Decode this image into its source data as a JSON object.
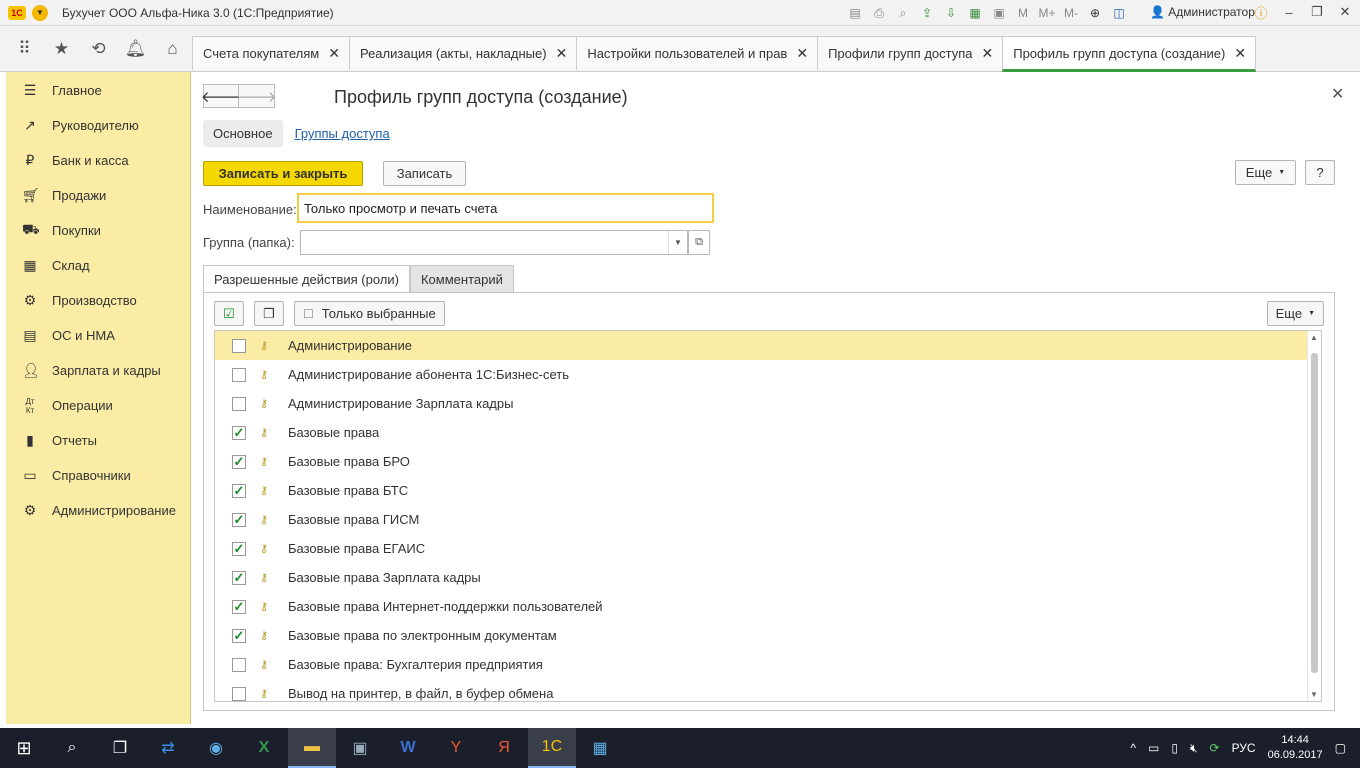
{
  "window": {
    "title": "Бухучет ООО  Альфа-Ника 3.0  (1С:Предприятие)",
    "logo_text": "1С",
    "user": "Администратор",
    "zoom_labels": [
      "M",
      "M+",
      "M-"
    ]
  },
  "tabs": [
    {
      "label": "Счета покупателям"
    },
    {
      "label": "Реализация (акты, накладные)"
    },
    {
      "label": "Настройки пользователей и прав"
    },
    {
      "label": "Профили групп доступа"
    },
    {
      "label": "Профиль групп доступа (создание)"
    }
  ],
  "sidebar": {
    "items": [
      {
        "label": "Главное",
        "icon": "menu-icon"
      },
      {
        "label": "Руководителю",
        "icon": "trend-icon"
      },
      {
        "label": "Банк и касса",
        "icon": "ruble-icon"
      },
      {
        "label": "Продажи",
        "icon": "cart-icon"
      },
      {
        "label": "Покупки",
        "icon": "truck-icon"
      },
      {
        "label": "Склад",
        "icon": "warehouse-icon"
      },
      {
        "label": "Производство",
        "icon": "factory-icon"
      },
      {
        "label": "ОС и НМА",
        "icon": "assets-icon"
      },
      {
        "label": "Зарплата и кадры",
        "icon": "person-icon"
      },
      {
        "label": "Операции",
        "icon": "dt-kt-icon"
      },
      {
        "label": "Отчеты",
        "icon": "bar-chart-icon"
      },
      {
        "label": "Справочники",
        "icon": "book-icon"
      },
      {
        "label": "Администрирование",
        "icon": "gear-icon"
      }
    ]
  },
  "form": {
    "title": "Профиль групп доступа (создание)",
    "subnav_main": "Основное",
    "subnav_link": "Группы доступа",
    "save_close_label": "Записать и закрыть",
    "save_label": "Записать",
    "more_label": "Еще",
    "help_label": "?",
    "name_label": "Наименование:",
    "name_value": "Только просмотр и печать счета",
    "group_label": "Группа (папка):",
    "group_value": "",
    "tab_roles": "Разрешенные действия (роли)",
    "tab_comment": "Комментарий",
    "only_selected_label": "Только выбранные",
    "list_more_label": "Еще"
  },
  "roles": [
    {
      "name": "Администрирование",
      "checked": false,
      "selected": true
    },
    {
      "name": "Администрирование абонента 1С:Бизнес-сеть",
      "checked": false
    },
    {
      "name": "Администрирование Зарплата кадры",
      "checked": false
    },
    {
      "name": "Базовые права",
      "checked": true
    },
    {
      "name": "Базовые права БРО",
      "checked": true
    },
    {
      "name": "Базовые права БТС",
      "checked": true
    },
    {
      "name": "Базовые права ГИСМ",
      "checked": true
    },
    {
      "name": "Базовые права ЕГАИС",
      "checked": true
    },
    {
      "name": "Базовые права Зарплата кадры",
      "checked": true
    },
    {
      "name": "Базовые права Интернет-поддержки пользователей",
      "checked": true
    },
    {
      "name": "Базовые права по электронным документам",
      "checked": true
    },
    {
      "name": "Базовые права: Бухгалтерия предприятия",
      "checked": false
    },
    {
      "name": "Вывод на принтер, в файл, в буфер обмена",
      "checked": false
    }
  ],
  "taskbar": {
    "language": "РУС",
    "time": "14:44",
    "date": "06.09.2017"
  },
  "colors": {
    "sidebar_bg": "#fbeca5",
    "primary_button": "#f5d800",
    "active_tab_accent": "#3b9d3b",
    "check_green": "#1a8c2a",
    "link": "#1f5fa8"
  }
}
